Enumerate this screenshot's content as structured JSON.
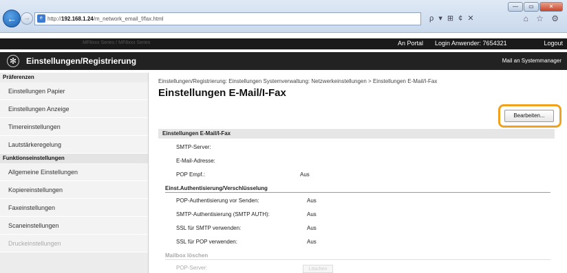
{
  "browser": {
    "url_prefix": "http://",
    "url_host": "192.168.1.24",
    "url_path": "/m_network_email_f/fax.html",
    "address_tools": "ρ ▾ ⊞ ¢ ✕",
    "right_icons": "⌂ ☆ ⚙",
    "window_buttons": [
      "—",
      "▭",
      "✕"
    ]
  },
  "topbar": {
    "device": "MF8xxx Series / MF8xxx Series",
    "portal": "An Portal",
    "login": "Login Anwender:  7654321",
    "logout": "Logout"
  },
  "titlebar": {
    "title": "Einstellungen/Registrierung",
    "mail": "Mail an Systemmanager"
  },
  "sidebar": {
    "head1": "Präferenzen",
    "items1": [
      "Einstellungen Papier",
      "Einstellungen Anzeige",
      "Timereinstellungen",
      "Lautstärkeregelung"
    ],
    "head2": "Funktionseinstellungen",
    "items2": [
      "Allgemeine Einstellungen",
      "Kopiereinstellungen",
      "Faxeinstellungen",
      "Scaneinstellungen",
      "Druckeinstellungen"
    ]
  },
  "main": {
    "breadcrumb": "Einstellungen/Registrierung: Einstellungen Systemverwaltung: Netzwerkeinstellungen > Einstellungen E-Mail/I-Fax",
    "title": "Einstellungen E-Mail/I-Fax",
    "edit_button": "Bearbeiten...",
    "section": "Einstellungen E-Mail/I-Fax",
    "rows1": [
      {
        "label": "SMTP-Server:",
        "value": ""
      },
      {
        "label": "E-Mail-Adresse:",
        "value": ""
      },
      {
        "label": "POP Empf.:",
        "value": "Aus"
      }
    ],
    "subhead1": "Einst.Authentisierung/Verschlüsselung",
    "rows2": [
      {
        "label": "POP-Authentisierung vor Senden:",
        "value": "Aus"
      },
      {
        "label": "SMTP-Authentisierung (SMTP AUTH):",
        "value": "Aus"
      },
      {
        "label": "SSL für SMTP verwenden:",
        "value": "Aus"
      },
      {
        "label": "SSL für POP verwenden:",
        "value": "Aus"
      }
    ],
    "subhead2": "Mailbox löschen",
    "row3_label": "POP-Server:",
    "row3_button": "Löschen"
  }
}
